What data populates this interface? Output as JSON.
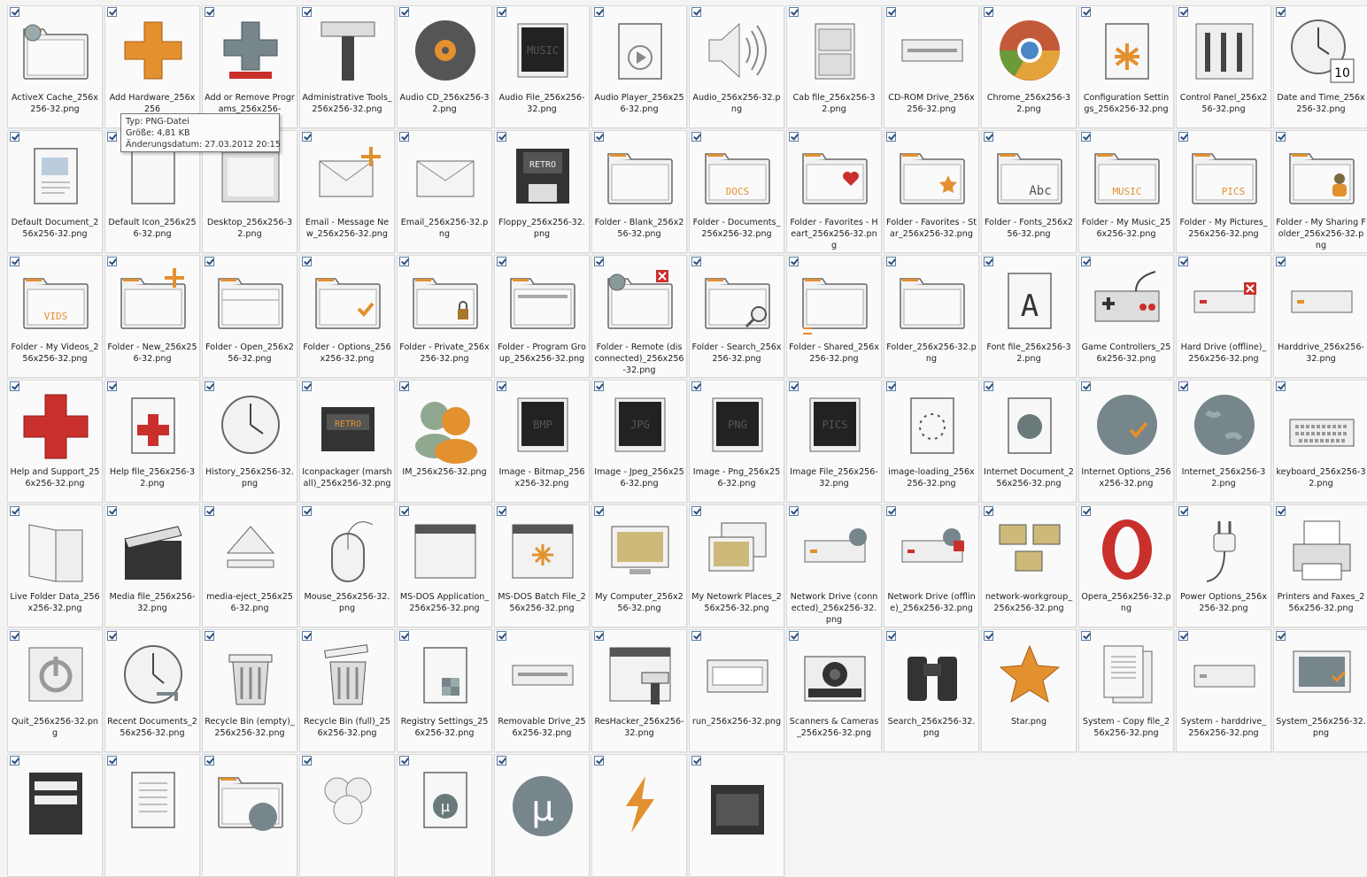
{
  "items": [
    {
      "label": "ActiveX Cache_256x256-32.png",
      "icon": "folder-disc-icon"
    },
    {
      "label": "Add Hardware_256x256",
      "icon": "plus-orange-icon"
    },
    {
      "label": "Add or Remove Programs_256x256-",
      "icon": "add-remove-icon"
    },
    {
      "label": "Administrative Tools_256x256-32.png",
      "icon": "hammer-icon"
    },
    {
      "label": "Audio CD_256x256-32.png",
      "icon": "cd-icon"
    },
    {
      "label": "Audio File_256x256-32.png",
      "icon": "music-file-icon"
    },
    {
      "label": "Audio Player_256x256-32.png",
      "icon": "audio-player-icon"
    },
    {
      "label": "Audio_256x256-32.png",
      "icon": "speaker-icon"
    },
    {
      "label": "Cab file_256x256-32.png",
      "icon": "cabinet-icon"
    },
    {
      "label": "CD-ROM Drive_256x256-32.png",
      "icon": "cdrom-drive-icon"
    },
    {
      "label": "Chrome_256x256-32.png",
      "icon": "chrome-icon"
    },
    {
      "label": "Configuration Settings_256x256-32.png",
      "icon": "config-icon"
    },
    {
      "label": "Control Panel_256x256-32.png",
      "icon": "sliders-icon"
    },
    {
      "label": "Date and Time_256x256-32.png",
      "icon": "clock-calendar-icon"
    },
    {
      "label": "Default Document_256x256-32.png",
      "icon": "document-icon"
    },
    {
      "label": "Default Icon_256x256-32.png",
      "icon": "blank-icon"
    },
    {
      "label": "Desktop_256x256-32.png",
      "icon": "desktop-icon"
    },
    {
      "label": "Email - Message New_256x256-32.png",
      "icon": "email-new-icon"
    },
    {
      "label": "Email_256x256-32.png",
      "icon": "email-icon"
    },
    {
      "label": "Floppy_256x256-32.png",
      "icon": "floppy-icon"
    },
    {
      "label": "Folder - Blank_256x256-32.png",
      "icon": "folder-icon"
    },
    {
      "label": "Folder - Documents_256x256-32.png",
      "icon": "folder-docs-icon"
    },
    {
      "label": "Folder - Favorites - Heart_256x256-32.png",
      "icon": "folder-heart-icon"
    },
    {
      "label": "Folder - Favorites - Star_256x256-32.png",
      "icon": "folder-star-icon"
    },
    {
      "label": "Folder - Fonts_256x256-32.png",
      "icon": "folder-fonts-icon"
    },
    {
      "label": "Folder - My Music_256x256-32.png",
      "icon": "folder-music-icon"
    },
    {
      "label": "Folder - My Pictures_256x256-32.png",
      "icon": "folder-pics-icon"
    },
    {
      "label": "Folder - My Sharing Folder_256x256-32.png",
      "icon": "folder-sharing-icon"
    },
    {
      "label": "Folder - My Videos_256x256-32.png",
      "icon": "folder-vids-icon"
    },
    {
      "label": "Folder - New_256x256-32.png",
      "icon": "folder-new-icon"
    },
    {
      "label": "Folder - Open_256x256-32.png",
      "icon": "folder-open-icon"
    },
    {
      "label": "Folder - Options_256x256-32.png",
      "icon": "folder-options-icon"
    },
    {
      "label": "Folder - Private_256x256-32.png",
      "icon": "folder-private-icon"
    },
    {
      "label": "Folder - Program Group_256x256-32.png",
      "icon": "folder-program-icon"
    },
    {
      "label": "Folder - Remote (disconnected)_256x256-32.png",
      "icon": "folder-remote-icon"
    },
    {
      "label": "Folder - Search_256x256-32.png",
      "icon": "folder-search-icon"
    },
    {
      "label": "Folder - Shared_256x256-32.png",
      "icon": "folder-shared-icon"
    },
    {
      "label": "Folder_256x256-32.png",
      "icon": "folder-plain-icon"
    },
    {
      "label": "Font file_256x256-32.png",
      "icon": "font-file-icon"
    },
    {
      "label": "Game Controllers_256x256-32.png",
      "icon": "gamepad-icon"
    },
    {
      "label": "Hard Drive (offline)_256x256-32.png",
      "icon": "harddrive-offline-icon"
    },
    {
      "label": "Harddrive_256x256-32.png",
      "icon": "harddrive-icon"
    },
    {
      "label": "Help and Support_256x256-32.png",
      "icon": "help-cross-icon"
    },
    {
      "label": "Help file_256x256-32.png",
      "icon": "help-file-icon"
    },
    {
      "label": "History_256x256-32.png",
      "icon": "history-clock-icon"
    },
    {
      "label": "Iconpackager (marshall)_256x256-32.png",
      "icon": "retro-radio-icon"
    },
    {
      "label": "IM_256x256-32.png",
      "icon": "im-users-icon"
    },
    {
      "label": "Image - Bitmap_256x256-32.png",
      "icon": "image-bmp-icon"
    },
    {
      "label": "Image - Jpeg_256x256-32.png",
      "icon": "image-jpg-icon"
    },
    {
      "label": "Image - Png_256x256-32.png",
      "icon": "image-png-icon"
    },
    {
      "label": "Image File_256x256-32.png",
      "icon": "image-file-icon"
    },
    {
      "label": "image-loading_256x256-32.png",
      "icon": "image-loading-icon"
    },
    {
      "label": "Internet Document_256x256-32.png",
      "icon": "internet-doc-icon"
    },
    {
      "label": "Internet Options_256x256-32.png",
      "icon": "globe-check-icon"
    },
    {
      "label": "Internet_256x256-32.png",
      "icon": "globe-icon"
    },
    {
      "label": "keyboard_256x256-32.png",
      "icon": "keyboard-icon"
    },
    {
      "label": "Live Folder Data_256x256-32.png",
      "icon": "live-folder-icon"
    },
    {
      "label": "Media file_256x256-32.png",
      "icon": "clapper-icon"
    },
    {
      "label": "media-eject_256x256-32.png",
      "icon": "eject-icon"
    },
    {
      "label": "Mouse_256x256-32.png",
      "icon": "mouse-icon"
    },
    {
      "label": "MS-DOS Application_256x256-32.png",
      "icon": "window-icon"
    },
    {
      "label": "MS-DOS Batch File_256x256-32.png",
      "icon": "window-gear-icon"
    },
    {
      "label": "My Computer_256x256-32.png",
      "icon": "monitor-icon"
    },
    {
      "label": "My Netowrk Places_256x256-32.png",
      "icon": "monitors-icon"
    },
    {
      "label": "Network Drive (connected)_256x256-32.png",
      "icon": "network-drive-icon"
    },
    {
      "label": "Network Drive (offline)_256x256-32.png",
      "icon": "network-drive-offline-icon"
    },
    {
      "label": "network-workgroup_256x256-32.png",
      "icon": "workgroup-icon"
    },
    {
      "label": "Opera_256x256-32.png",
      "icon": "opera-icon"
    },
    {
      "label": "Power Options_256x256-32.png",
      "icon": "power-plug-icon"
    },
    {
      "label": "Printers and Faxes_256x256-32.png",
      "icon": "printer-icon"
    },
    {
      "label": "Quit_256x256-32.png",
      "icon": "quit-icon"
    },
    {
      "label": "Recent Documents_256x256-32.png",
      "icon": "recent-clock-icon"
    },
    {
      "label": "Recycle Bin (empty)_256x256-32.png",
      "icon": "trash-empty-icon"
    },
    {
      "label": "Recycle Bin (full)_256x256-32.png",
      "icon": "trash-full-icon"
    },
    {
      "label": "Registry Settings_256x256-32.png",
      "icon": "registry-icon"
    },
    {
      "label": "Removable Drive_256x256-32.png",
      "icon": "removable-drive-icon"
    },
    {
      "label": "ResHacker_256x256-32.png",
      "icon": "reshacker-icon"
    },
    {
      "label": "run_256x256-32.png",
      "icon": "run-icon"
    },
    {
      "label": "Scanners & Cameras_256x256-32.png",
      "icon": "camera-icon"
    },
    {
      "label": "Search_256x256-32.png",
      "icon": "binoculars-icon"
    },
    {
      "label": "Star.png",
      "icon": "star-icon"
    },
    {
      "label": "System - Copy file_256x256-32.png",
      "icon": "copy-file-icon"
    },
    {
      "label": "System - harddrive_256x256-32.png",
      "icon": "system-harddrive-icon"
    },
    {
      "label": "System_256x256-32.png",
      "icon": "system-monitor-icon"
    },
    {
      "label": "",
      "icon": "drive-stack-icon"
    },
    {
      "label": "",
      "icon": "text-doc-icon"
    },
    {
      "label": "",
      "icon": "folder-globe-icon"
    },
    {
      "label": "",
      "icon": "users-group-icon"
    },
    {
      "label": "",
      "icon": "torrent-file-icon"
    },
    {
      "label": "",
      "icon": "utorrent-icon"
    },
    {
      "label": "",
      "icon": "winamp-icon"
    },
    {
      "label": "",
      "icon": "radio-icon"
    }
  ],
  "tooltip": {
    "type": "Typ: PNG-Datei",
    "size": "Größe: 4,81 KB",
    "date": "Änderungsdatum: 27.03.2012 20:15"
  },
  "colors": {
    "orange": "#e3902e",
    "red": "#c9302c",
    "gray": "#76868a",
    "dark": "#3a3a3a",
    "folder": "#d8d8d8"
  }
}
